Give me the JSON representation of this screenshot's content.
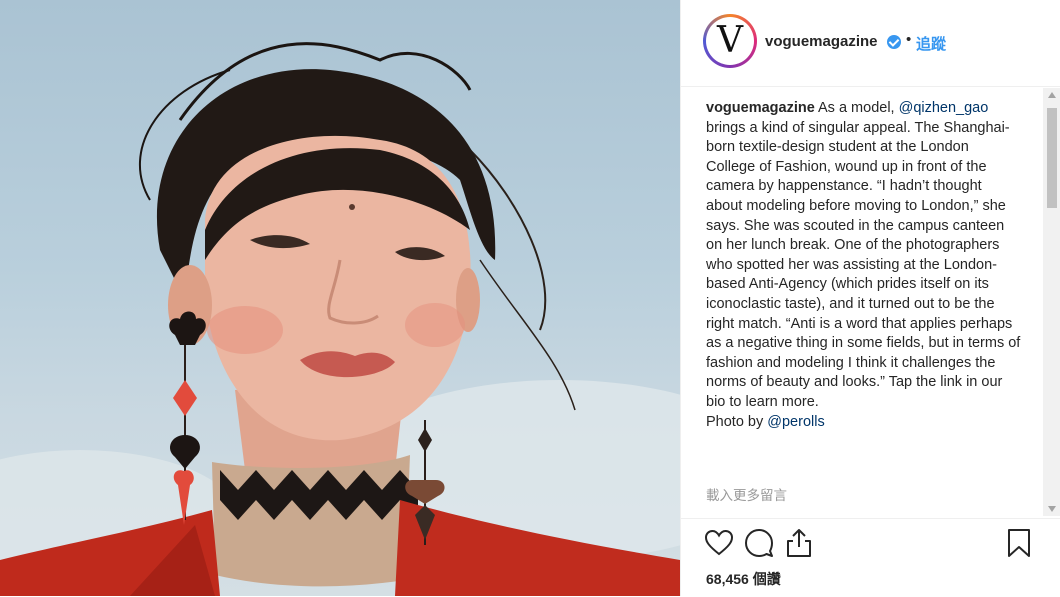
{
  "post": {
    "image_alt": "Portrait of model with wind-swept dark hair, red jacket and playing-card earrings against a pale blue sky"
  },
  "header": {
    "username": "voguemagazine",
    "avatar_letter": "V",
    "separator": "•",
    "follow_label": "追蹤"
  },
  "caption": {
    "username": "voguemagazine",
    "text_before": "As a model, ",
    "mention1": "@qizhen_gao",
    "text_mid": " brings a kind of singular appeal. The Shanghai-born textile-design student at the London College of Fashion, wound up in front of the camera by happenstance. “I hadn’t thought about modeling before moving to London,” she says. She was scouted in the campus canteen on her lunch break. One of the photographers who spotted her was assisting at the London-based Anti-Agency (which prides itself on its iconoclastic taste), and it turned out to be the right match. “Anti is a word that applies perhaps as a negative thing in some fields, but in terms of fashion and modeling I think it challenges the norms of beauty and looks.” Tap the link in our bio to learn more.",
    "photo_by": "Photo by ",
    "mention2": "@perolls",
    "load_more": "載入更多留言"
  },
  "actions": {
    "like_icon": "heart-icon",
    "comment_icon": "comment-icon",
    "share_icon": "share-icon",
    "save_icon": "bookmark-icon",
    "views": "68,456 個讚"
  },
  "colors": {
    "link": "#003569",
    "follow": "#3897f0",
    "verified": "#3897f0",
    "text": "#262626",
    "muted": "#999999"
  }
}
